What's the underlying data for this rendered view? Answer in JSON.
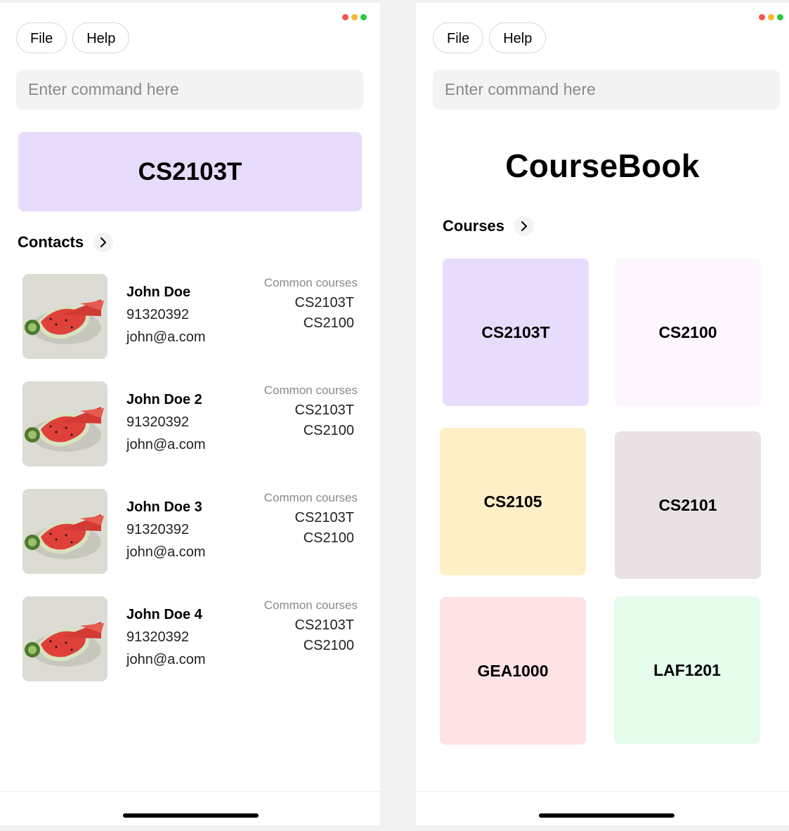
{
  "window_controls": {
    "close_color": "#f05a50",
    "minimize_color": "#f5b82e",
    "maximize_color": "#2bc840"
  },
  "left": {
    "menu": {
      "file_label": "File",
      "help_label": "Help"
    },
    "command": {
      "placeholder": "Enter command here"
    },
    "course_banner": {
      "code": "CS2103T",
      "color": "#e8dcfd"
    },
    "contacts_heading": "Contacts",
    "contacts": [
      {
        "name": "John Doe",
        "phone": "91320392",
        "email": "john@a.com",
        "common_label": "Common courses",
        "courses": [
          "CS2103T",
          "CS2100"
        ]
      },
      {
        "name": "John Doe 2",
        "phone": "91320392",
        "email": "john@a.com",
        "common_label": "Common courses",
        "courses": [
          "CS2103T",
          "CS2100"
        ]
      },
      {
        "name": "John Doe 3",
        "phone": "91320392",
        "email": "john@a.com",
        "common_label": "Common courses",
        "courses": [
          "CS2103T",
          "CS2100"
        ]
      },
      {
        "name": "John Doe 4",
        "phone": "91320392",
        "email": "john@a.com",
        "common_label": "Common courses",
        "courses": [
          "CS2103T",
          "CS2100"
        ]
      }
    ]
  },
  "right": {
    "menu": {
      "file_label": "File",
      "help_label": "Help"
    },
    "command": {
      "placeholder": "Enter command here"
    },
    "app_title": "CourseBook",
    "courses_heading": "Courses",
    "courses": [
      {
        "code": "CS2103T",
        "color": "#e8dcfd"
      },
      {
        "code": "CS2100",
        "color": "#fdf6fe"
      },
      {
        "code": "CS2105",
        "color": "#fdf0c6"
      },
      {
        "code": "CS2101",
        "color": "#e8e2e4"
      },
      {
        "code": "GEA1000",
        "color": "#fde2e4"
      },
      {
        "code": "LAF1201",
        "color": "#e6fdec"
      }
    ]
  }
}
